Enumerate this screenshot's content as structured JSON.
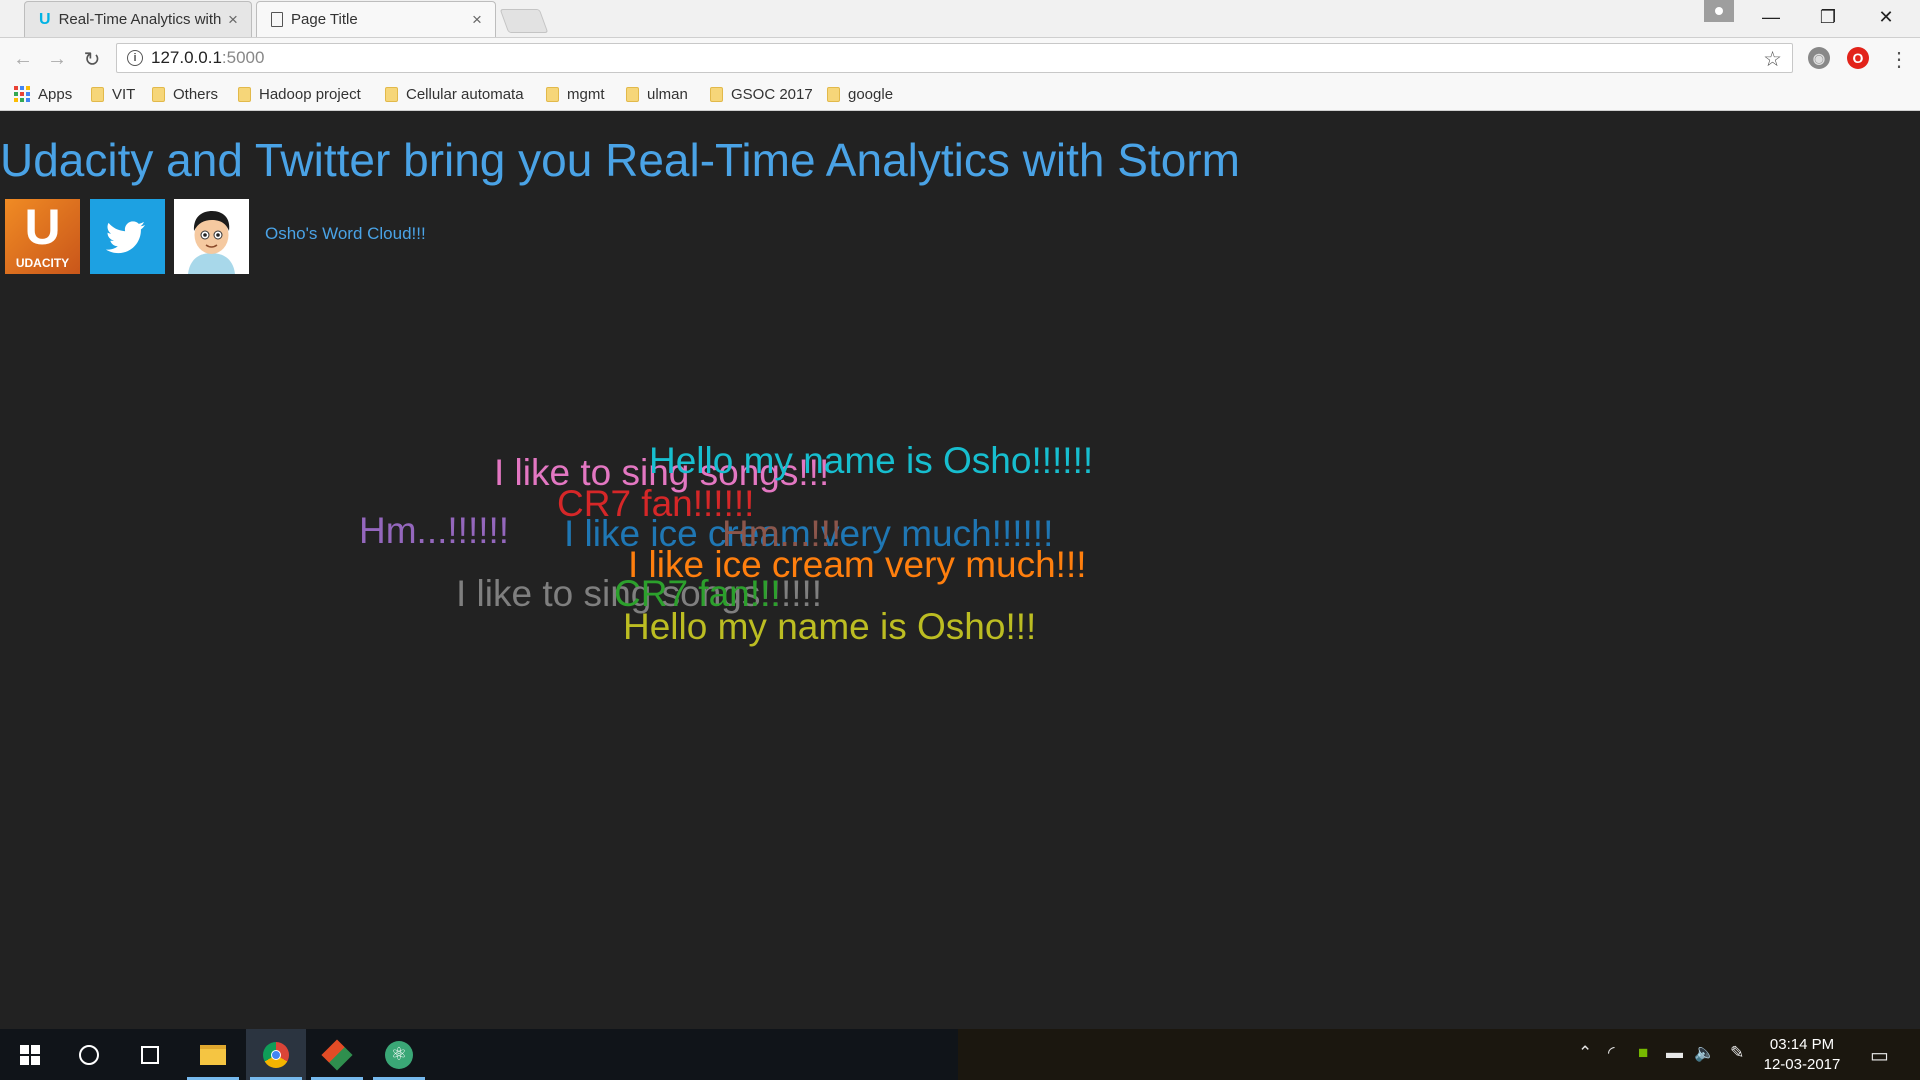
{
  "browser": {
    "tabs": [
      {
        "title": "Real-Time Analytics with",
        "close": "×"
      },
      {
        "title": "Page Title",
        "close": "×"
      }
    ],
    "window_controls": {
      "minimize": "—",
      "restore": "❐",
      "close": "✕"
    },
    "address": {
      "host": "127.0.0.1",
      "port": ":5000"
    },
    "bookmarks": [
      {
        "label": "Apps"
      },
      {
        "label": "VIT"
      },
      {
        "label": "Others"
      },
      {
        "label": "Hadoop project"
      },
      {
        "label": "Cellular automata"
      },
      {
        "label": "mgmt"
      },
      {
        "label": "ulman"
      },
      {
        "label": "GSOC 2017"
      },
      {
        "label": "google"
      }
    ]
  },
  "page": {
    "title": "Udacity and Twitter bring you Real-Time Analytics with Storm",
    "logos": {
      "udacity_letter": "U",
      "udacity_text": "UDACITY"
    },
    "word_cloud_link": "Osho's Word Cloud!!!",
    "word_cloud": [
      {
        "text": "I like to sing songs!!!",
        "color": "#e377c2"
      },
      {
        "text": "Hello my name is Osho!!!!!!",
        "color": "#17becf"
      },
      {
        "text": "CR7 fan!!!!!!",
        "color": "#d62728"
      },
      {
        "text": "Hm...!!!!!!",
        "color": "#9467bd"
      },
      {
        "text": "I like ice cream very much!!!!!!",
        "color": "#1f77b4"
      },
      {
        "text": "Hm...!!!",
        "color": "#8c564b"
      },
      {
        "text": "I like ice cream very much!!!",
        "color": "#ff7f0e"
      },
      {
        "text": "I like to sing songs!!!!!!",
        "color": "#7f7f7f"
      },
      {
        "text": "CR7 fan!!!",
        "color": "#2ca02c"
      },
      {
        "text": "Hello my name is Osho!!!",
        "color": "#bcbd22"
      }
    ]
  },
  "taskbar": {
    "time": "03:14 PM",
    "date": "12-03-2017"
  }
}
